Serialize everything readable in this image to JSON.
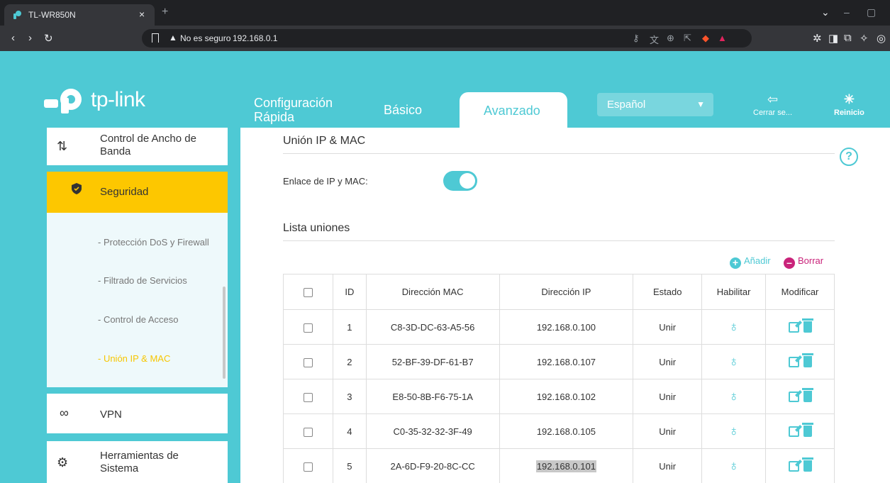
{
  "browser": {
    "tab_title": "TL-WR850N",
    "security_label": "No es seguro",
    "url": "192.168.0.1"
  },
  "header": {
    "logo": "tp-link",
    "tabs": [
      {
        "label_line1": "Configuración",
        "label_line2": "Rápida"
      },
      {
        "label": "Básico"
      },
      {
        "label": "Avanzado"
      }
    ],
    "language": "Español",
    "logout_label": "Cerrar se...",
    "reboot_label": "Reinicio"
  },
  "sidebar": {
    "items": [
      {
        "line1": "Control de Ancho de",
        "line2": "Banda",
        "icon": "up-down-arrows-icon"
      },
      {
        "label": "Seguridad",
        "icon": "shield-icon"
      },
      {
        "label": "VPN",
        "icon": "vpn-link-icon"
      },
      {
        "line1": "Herramientas de",
        "line2": "Sistema",
        "icon": "gear-icon"
      }
    ],
    "subitems": [
      "- Protección DoS y Firewall",
      "- Filtrado de Servicios",
      "- Control de Acceso",
      "- Unión IP & MAC"
    ]
  },
  "main": {
    "section_title": "Unión IP & MAC",
    "binding_label": "Enlace de IP y MAC:",
    "binding_enabled": true,
    "list_title": "Lista uniones",
    "add_label": "Añadir",
    "delete_label": "Borrar",
    "table": {
      "headers": [
        "ID",
        "Dirección MAC",
        "Dirección IP",
        "Estado",
        "Habilitar",
        "Modificar"
      ],
      "rows": [
        {
          "id": "1",
          "mac": "C8-3D-DC-63-A5-56",
          "ip": "192.168.0.100",
          "status": "Unir"
        },
        {
          "id": "2",
          "mac": "52-BF-39-DF-61-B7",
          "ip": "192.168.0.107",
          "status": "Unir"
        },
        {
          "id": "3",
          "mac": "E8-50-8B-F6-75-1A",
          "ip": "192.168.0.102",
          "status": "Unir"
        },
        {
          "id": "4",
          "mac": "C0-35-32-32-3F-49",
          "ip": "192.168.0.105",
          "status": "Unir"
        },
        {
          "id": "5",
          "mac": "2A-6D-F9-20-8C-CC",
          "ip": "192.168.0.101",
          "status": "Unir"
        }
      ]
    }
  },
  "colors": {
    "brand": "#4ec9d4",
    "active_menu": "#fdc700",
    "add": "#4ec9d4",
    "delete": "#c9237a"
  }
}
